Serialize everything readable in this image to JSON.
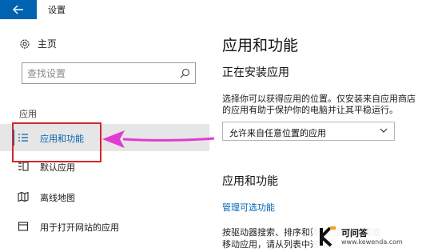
{
  "window": {
    "title": "设置"
  },
  "sidebar": {
    "home_label": "主页",
    "search_placeholder": "查找设置",
    "section_label": "应用",
    "items": [
      {
        "label": "应用和功能",
        "icon": "list-icon"
      },
      {
        "label": "默认应用",
        "icon": "default-apps-icon"
      },
      {
        "label": "离线地图",
        "icon": "map-icon"
      },
      {
        "label": "用于打开网站的应用",
        "icon": "web-apps-icon"
      }
    ]
  },
  "main": {
    "title": "应用和功能",
    "installing_title": "正在安装应用",
    "description": "选择你可以获得应用的位置。仅安装来自应用商店的应用有助于保护你的电脑并让其平稳运行。",
    "dropdown_value": "允许来自任意位置的应用",
    "apps_section_title": "应用和功能",
    "manage_link": "管理可选功能",
    "sort_desc": "按驱动器搜索、排序和筛选。如需卸载或移动应用，请从列表中选择它。"
  },
  "watermark": {
    "name": "可问答",
    "url": "www.kewenda.com"
  },
  "colors": {
    "accent": "#0063b1",
    "highlight": "#d3262c",
    "arrow": "#e33bd0"
  }
}
